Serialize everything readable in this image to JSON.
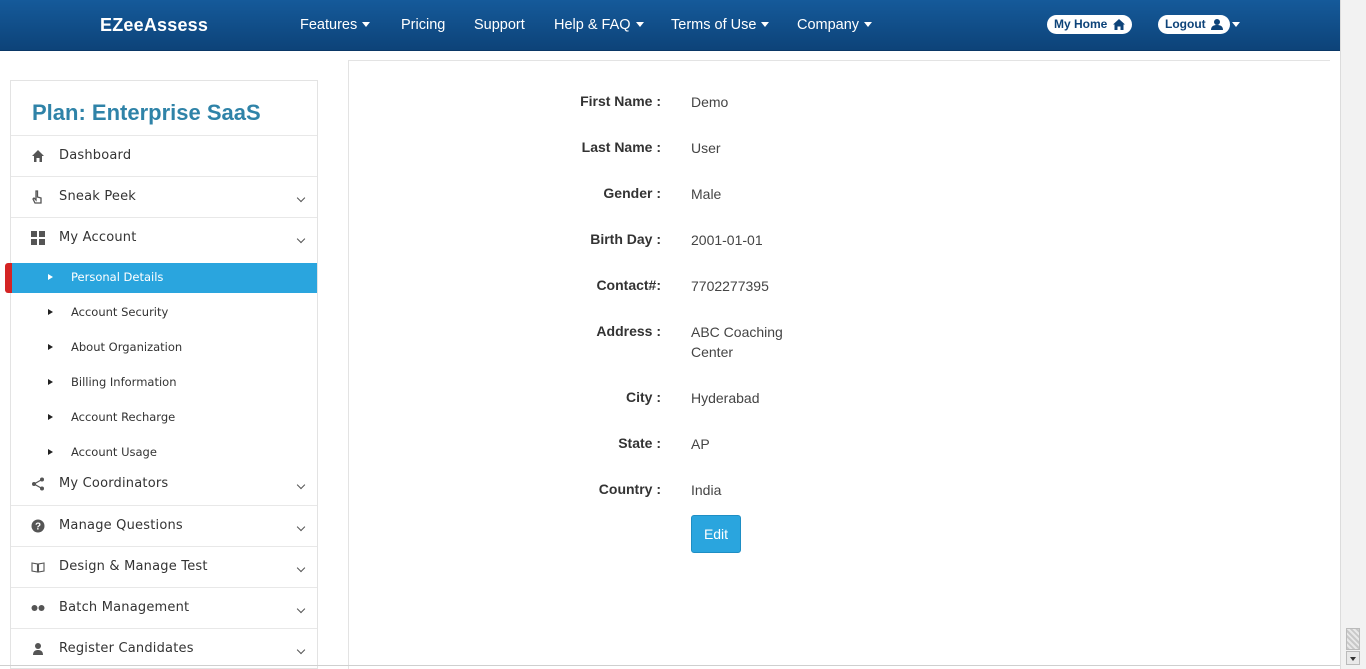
{
  "navbar": {
    "brand": "EZeeAssess",
    "items": [
      {
        "label": "Features",
        "dropdown": true
      },
      {
        "label": "Pricing",
        "dropdown": false
      },
      {
        "label": "Support",
        "dropdown": false
      },
      {
        "label": "Help & FAQ",
        "dropdown": true
      },
      {
        "label": "Terms of Use",
        "dropdown": true
      },
      {
        "label": "Company",
        "dropdown": true
      }
    ],
    "my_home": "My Home",
    "logout": "Logout"
  },
  "sidebar": {
    "plan_title": "Plan: Enterprise SaaS",
    "items": [
      {
        "label": "Dashboard",
        "icon": "home-icon",
        "expandable": false
      },
      {
        "label": "Sneak Peek",
        "icon": "pointer-icon",
        "expandable": true
      },
      {
        "label": "My Account",
        "icon": "grid-icon",
        "expandable": true
      },
      {
        "label": "My Coordinators",
        "icon": "share-icon",
        "expandable": true
      },
      {
        "label": "Manage Questions",
        "icon": "question-icon",
        "expandable": true
      },
      {
        "label": "Design & Manage Test",
        "icon": "book-icon",
        "expandable": true
      },
      {
        "label": "Batch Management",
        "icon": "dots-icon",
        "expandable": true
      },
      {
        "label": "Register Candidates",
        "icon": "user-icon",
        "expandable": true
      }
    ],
    "sub_items": [
      {
        "label": "Personal Details",
        "active": true
      },
      {
        "label": "Account Security",
        "active": false
      },
      {
        "label": "About Organization",
        "active": false
      },
      {
        "label": "Billing Information",
        "active": false
      },
      {
        "label": "Account Recharge",
        "active": false
      },
      {
        "label": "Account Usage",
        "active": false
      }
    ]
  },
  "details": {
    "fields": [
      {
        "label": "First Name :",
        "value": "Demo"
      },
      {
        "label": "Last Name :",
        "value": "User"
      },
      {
        "label": "Gender :",
        "value": "Male"
      },
      {
        "label": "Birth Day :",
        "value": "2001-01-01"
      },
      {
        "label": "Contact#:",
        "value": "7702277395"
      },
      {
        "label": "Address :",
        "value": "ABC Coaching",
        "value_line2": "Center"
      },
      {
        "label": "City :",
        "value": "Hyderabad"
      },
      {
        "label": "State :",
        "value": "AP"
      },
      {
        "label": "Country :",
        "value": "India"
      }
    ],
    "edit_label": "Edit"
  },
  "colors": {
    "navbar": "#0d4379",
    "accent": "#2aa5de",
    "plan_title": "#2f83a8",
    "active_marker": "#d42424"
  }
}
